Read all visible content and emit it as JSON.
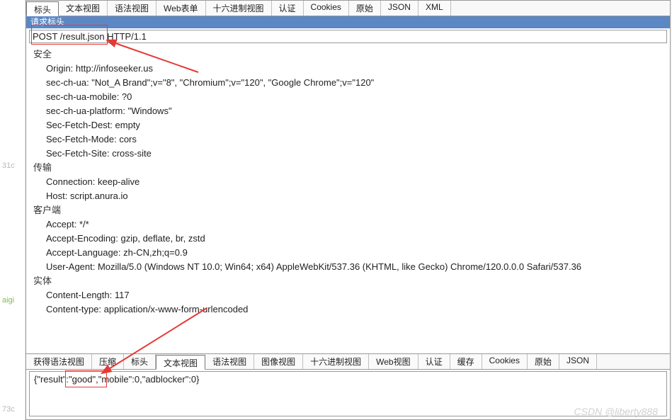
{
  "left_strip": {
    "a": "31c",
    "b": "aigi",
    "c": "73c"
  },
  "top_tabs": [
    {
      "label": "标头",
      "active": true
    },
    {
      "label": "文本视图"
    },
    {
      "label": "语法视图"
    },
    {
      "label": "Web表单"
    },
    {
      "label": "十六进制视图"
    },
    {
      "label": "认证"
    },
    {
      "label": "Cookies"
    },
    {
      "label": "原始"
    },
    {
      "label": "JSON"
    },
    {
      "label": "XML"
    }
  ],
  "panel_header": "请求标头",
  "request_line": "POST /result.json HTTP/1.1",
  "groups": [
    {
      "title": "安全",
      "items": [
        "Origin: http://infoseeker.us",
        "sec-ch-ua: \"Not_A Brand\";v=\"8\", \"Chromium\";v=\"120\", \"Google Chrome\";v=\"120\"",
        "sec-ch-ua-mobile: ?0",
        "sec-ch-ua-platform: \"Windows\"",
        "Sec-Fetch-Dest: empty",
        "Sec-Fetch-Mode: cors",
        "Sec-Fetch-Site: cross-site"
      ]
    },
    {
      "title": "传输",
      "items": [
        "Connection: keep-alive",
        "Host: script.anura.io"
      ]
    },
    {
      "title": "客户端",
      "items": [
        "Accept: */*",
        "Accept-Encoding: gzip, deflate, br, zstd",
        "Accept-Language: zh-CN,zh;q=0.9",
        "User-Agent: Mozilla/5.0 (Windows NT 10.0; Win64; x64) AppleWebKit/537.36 (KHTML, like Gecko) Chrome/120.0.0.0 Safari/537.36"
      ]
    },
    {
      "title": "实体",
      "items": [
        "Content-Length: 117",
        "Content-type: application/x-www-form-urlencoded"
      ]
    }
  ],
  "bottom_tabs": [
    {
      "label": "获得语法视图"
    },
    {
      "label": "压缩"
    },
    {
      "label": "标头"
    },
    {
      "label": "文本视图",
      "active": true
    },
    {
      "label": "语法视图"
    },
    {
      "label": "图像视图"
    },
    {
      "label": "十六进制视图"
    },
    {
      "label": "Web视图"
    },
    {
      "label": "认证"
    },
    {
      "label": "缓存"
    },
    {
      "label": "Cookies"
    },
    {
      "label": "原始"
    },
    {
      "label": "JSON"
    }
  ],
  "response_body": "{\"result\":\"good\",\"mobile\":0,\"adblocker\":0}",
  "watermark": "CSDN @liberty888"
}
